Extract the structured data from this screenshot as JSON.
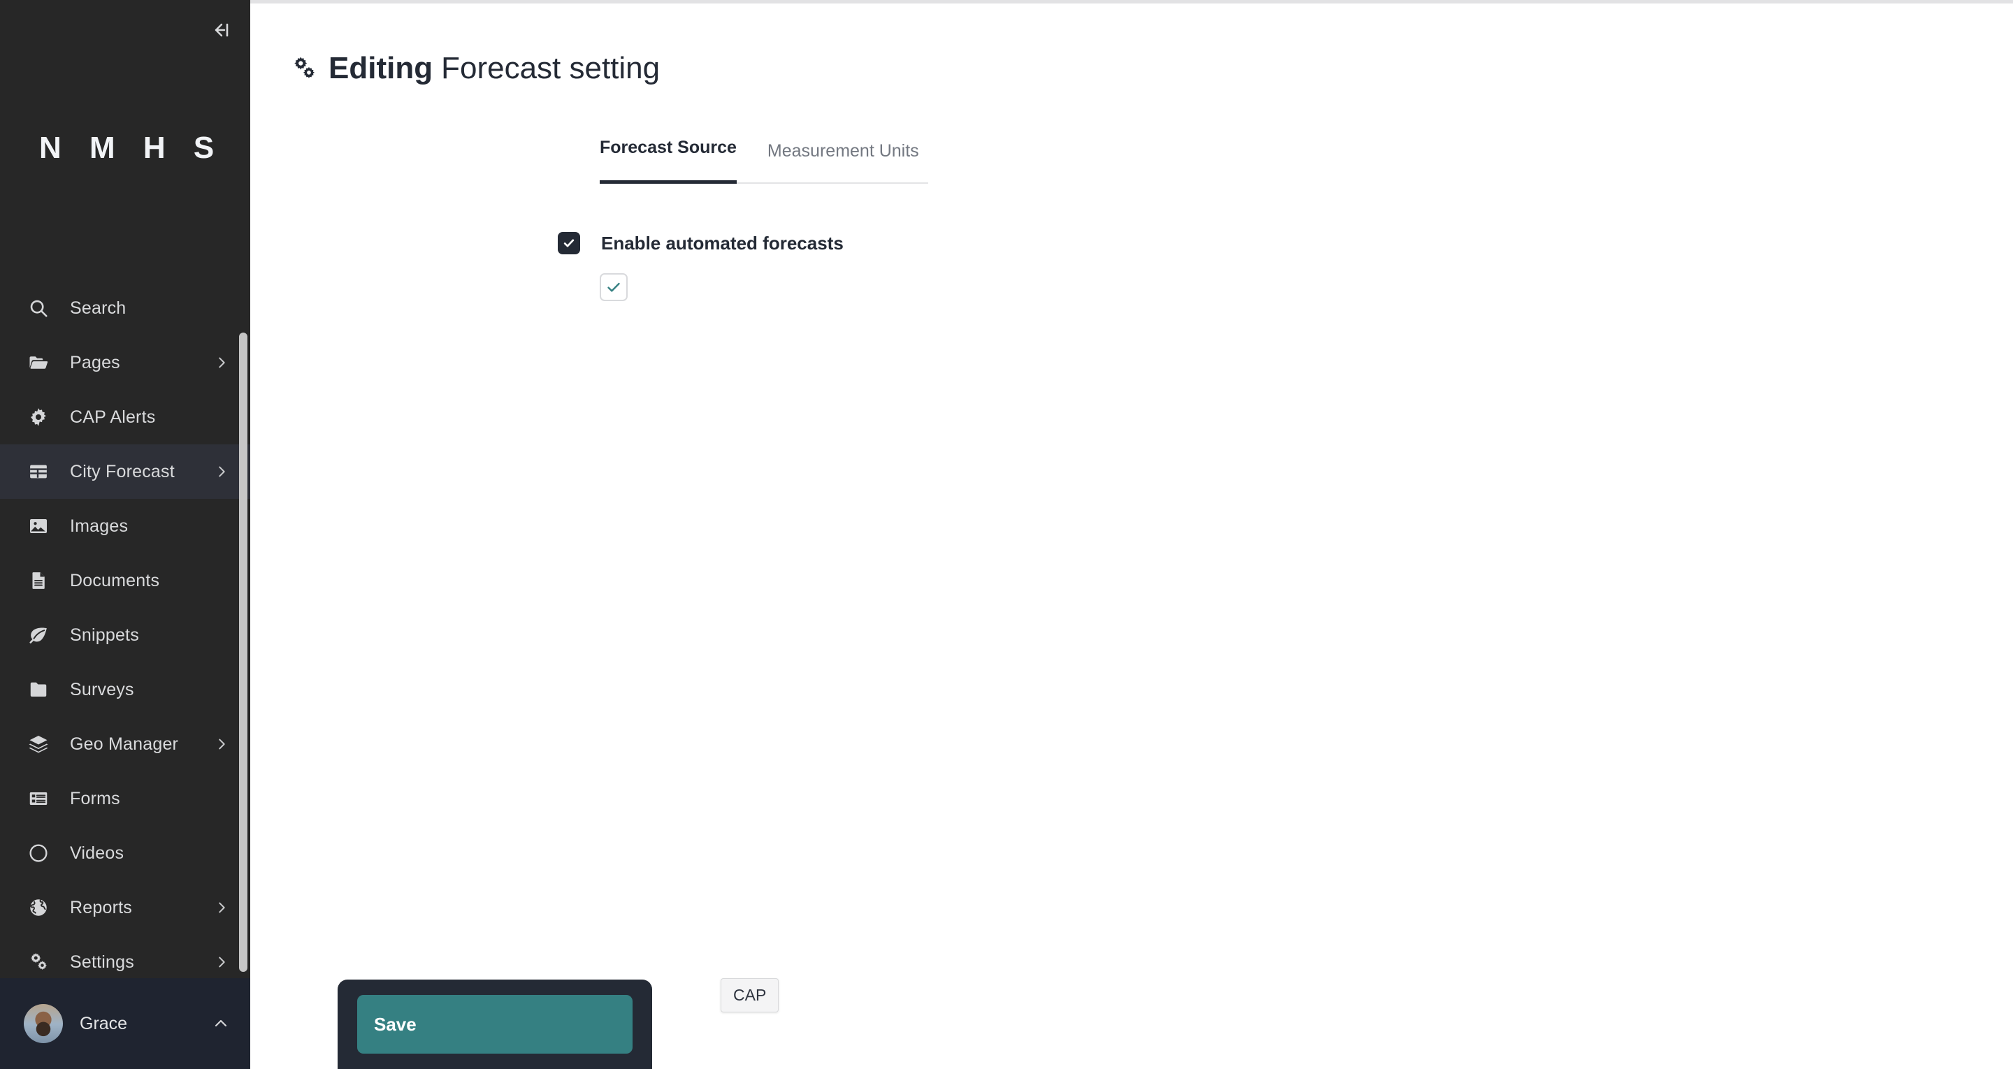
{
  "sidebar": {
    "collapse_icon": "collapse-left-icon",
    "brand": "N M H S",
    "items": [
      {
        "label": "Search",
        "icon": "search-icon",
        "chevron": false,
        "active": false
      },
      {
        "label": "Pages",
        "icon": "folder-open-icon",
        "chevron": true,
        "active": false
      },
      {
        "label": "CAP Alerts",
        "icon": "gear-icon",
        "chevron": false,
        "active": false
      },
      {
        "label": "City Forecast",
        "icon": "table-icon",
        "chevron": true,
        "active": true
      },
      {
        "label": "Images",
        "icon": "image-icon",
        "chevron": false,
        "active": false
      },
      {
        "label": "Documents",
        "icon": "document-icon",
        "chevron": false,
        "active": false
      },
      {
        "label": "Snippets",
        "icon": "leaf-icon",
        "chevron": false,
        "active": false
      },
      {
        "label": "Surveys",
        "icon": "folder-icon",
        "chevron": false,
        "active": false
      },
      {
        "label": "Geo Manager",
        "icon": "layers-icon",
        "chevron": true,
        "active": false
      },
      {
        "label": "Forms",
        "icon": "list-form-icon",
        "chevron": false,
        "active": false
      },
      {
        "label": "Videos",
        "icon": "circle-icon",
        "chevron": false,
        "active": false
      },
      {
        "label": "Reports",
        "icon": "globe-icon",
        "chevron": true,
        "active": false
      },
      {
        "label": "Settings",
        "icon": "cogs-icon",
        "chevron": true,
        "active": false
      }
    ],
    "user": {
      "name": "Grace",
      "avatar": "avatar",
      "chevron_icon": "chevron-up-icon"
    }
  },
  "header": {
    "icon": "cogs-icon",
    "title_strong": "Editing",
    "title_light": "Forecast setting"
  },
  "tabs": [
    {
      "label": "Forecast Source",
      "active": true
    },
    {
      "label": "Measurement Units",
      "active": false
    }
  ],
  "form": {
    "checkbox_checked": true,
    "checkbox_label": "Enable automated forecasts",
    "toggle_checked": true
  },
  "footer": {
    "save_label": "Save"
  },
  "tooltip": {
    "text": "CAP"
  },
  "colors": {
    "sidebar_bg": "#272727",
    "sidebar_active": "#2e3038",
    "user_bar_bg": "#1f2430",
    "ink": "#242a35",
    "accent_teal": "#358082",
    "muted": "#737881"
  }
}
